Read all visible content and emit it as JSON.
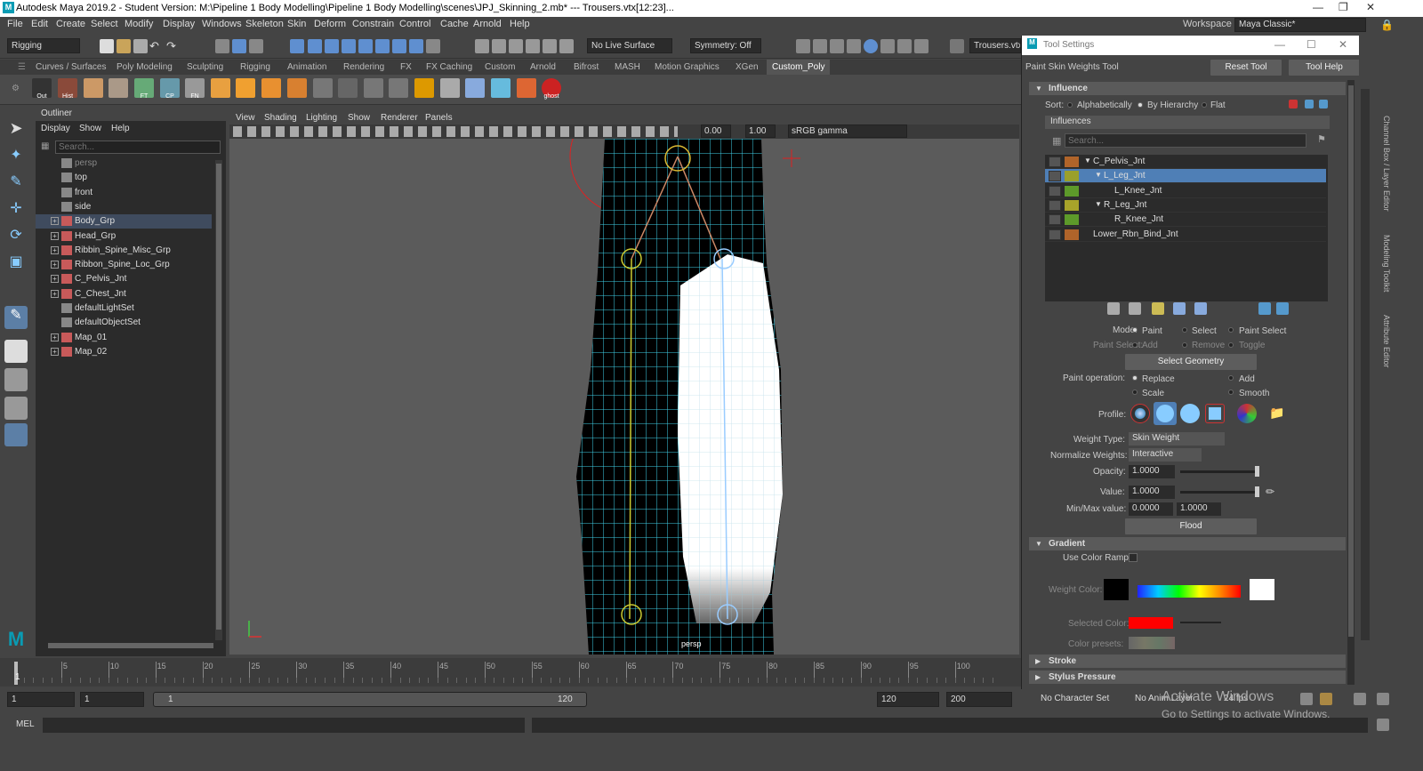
{
  "title": "Autodesk Maya 2019.2 - Student Version: M:\\Pipeline 1 Body Modelling\\Pipeline 1 Body Modelling\\scenes\\JPJ_Skinning_2.mb*  ---  Trousers.vtx[12:23]...",
  "menu": [
    "File",
    "Edit",
    "Create",
    "Select",
    "Modify",
    "Display",
    "Windows",
    "Skeleton",
    "Skin",
    "Deform",
    "Constrain",
    "Control",
    "Cache",
    "Arnold",
    "Help"
  ],
  "workspace": {
    "label": "Workspace :",
    "value": "Maya Classic*"
  },
  "status": {
    "menuset": "Rigging",
    "live_surface": "No Live Surface",
    "symmetry": "Symmetry: Off",
    "object_name": "Trousers.vtx"
  },
  "shelf_tabs": [
    "Curves / Surfaces",
    "Poly Modeling",
    "Sculpting",
    "Rigging",
    "Animation",
    "Rendering",
    "FX",
    "FX Caching",
    "Custom",
    "Arnold",
    "Bifrost",
    "MASH",
    "Motion Graphics",
    "XGen",
    "Custom_Poly"
  ],
  "shelf_labels": {
    "out": "Out",
    "hist": "Hist",
    "ft": "FT",
    "cp": "CP",
    "fn": "FN",
    "ghost": "ghost"
  },
  "outliner": {
    "title": "Outliner",
    "menu": [
      "Display",
      "Show",
      "Help"
    ],
    "search_placeholder": "Search...",
    "items": [
      {
        "label": "persp",
        "dim": true
      },
      {
        "label": "top"
      },
      {
        "label": "front"
      },
      {
        "label": "side"
      },
      {
        "label": "Body_Grp",
        "exp": true,
        "sel": true
      },
      {
        "label": "Head_Grp",
        "exp": true
      },
      {
        "label": "Ribbin_Spine_Misc_Grp",
        "exp": true
      },
      {
        "label": "Ribbon_Spine_Loc_Grp",
        "exp": true
      },
      {
        "label": "C_Pelvis_Jnt",
        "exp": true
      },
      {
        "label": "C_Chest_Jnt",
        "exp": true
      },
      {
        "label": "defaultLightSet"
      },
      {
        "label": "defaultObjectSet"
      },
      {
        "label": "Map_01",
        "exp": true
      },
      {
        "label": "Map_02",
        "exp": true
      }
    ]
  },
  "viewport": {
    "menu": [
      "View",
      "Shading",
      "Lighting",
      "Show",
      "Renderer",
      "Panels"
    ],
    "field1": "0.00",
    "field2": "1.00",
    "colorspace": "sRGB gamma",
    "camera": "persp"
  },
  "timeline": {
    "ticks": [
      "5",
      "10",
      "15",
      "20",
      "25",
      "30",
      "35",
      "40",
      "45",
      "50",
      "55",
      "60",
      "65",
      "70",
      "75",
      "80",
      "85",
      "90",
      "95",
      "100"
    ],
    "current": "1"
  },
  "range": {
    "start": "1",
    "current": "1",
    "slider_start": "1",
    "slider_end": "120",
    "end": "120",
    "max": "200",
    "char_set": "No Character Set",
    "anim_layer": "No Anim Layer",
    "fps": "24 fps"
  },
  "mel": {
    "label": "MEL"
  },
  "tool_settings": {
    "window_title": "Tool Settings",
    "tool_name": "Paint Skin Weights Tool",
    "reset": "Reset Tool",
    "help": "Tool Help",
    "influence_header": "Influence",
    "sort_label": "Sort:",
    "sort_options": [
      "Alphabetically",
      "By Hierarchy",
      "Flat"
    ],
    "influences_label": "Influences",
    "search_placeholder": "Search...",
    "influences": [
      {
        "name": "C_Pelvis_Jnt",
        "color": "#b0642a",
        "indent": 0,
        "tri": true
      },
      {
        "name": "L_Leg_Jnt",
        "color": "#9aa02b",
        "indent": 1,
        "tri": true,
        "sel": true
      },
      {
        "name": "L_Knee_Jnt",
        "color": "#5d9a2a",
        "indent": 2
      },
      {
        "name": "R_Leg_Jnt",
        "color": "#a8a32a",
        "indent": 1,
        "tri": true
      },
      {
        "name": "R_Knee_Jnt",
        "color": "#5d9a2a",
        "indent": 2
      },
      {
        "name": "Lower_Rbn_Bind_Jnt",
        "color": "#b0642a",
        "indent": 0
      }
    ],
    "mode_label": "Mode:",
    "mode_options": [
      "Paint",
      "Select",
      "Paint Select"
    ],
    "paint_select_label": "Paint Select:",
    "paint_select_options": [
      "Add",
      "Remove",
      "Toggle"
    ],
    "select_geometry": "Select Geometry",
    "paint_op_label": "Paint operation:",
    "paint_ops": [
      "Replace",
      "Add",
      "Scale",
      "Smooth"
    ],
    "profile_label": "Profile:",
    "weight_type_label": "Weight Type:",
    "weight_type": "Skin Weight",
    "normalize_label": "Normalize Weights:",
    "normalize": "Interactive",
    "opacity_label": "Opacity:",
    "opacity": "1.0000",
    "value_label": "Value:",
    "value": "1.0000",
    "minmax_label": "Min/Max value:",
    "min": "0.0000",
    "max": "1.0000",
    "flood": "Flood",
    "gradient_header": "Gradient",
    "use_color_ramp": "Use Color Ramp",
    "weight_color_label": "Weight Color:",
    "selected_color_label": "Selected Color:",
    "color_presets_label": "Color presets:",
    "stroke_header": "Stroke",
    "stylus_header": "Stylus Pressure"
  },
  "right_panels": [
    "Channel Box / Layer Editor",
    "Modeling Toolkit",
    "Attribute Editor"
  ],
  "watermark": {
    "line1": "Activate Windows",
    "line2": "Go to Settings to activate Windows."
  }
}
